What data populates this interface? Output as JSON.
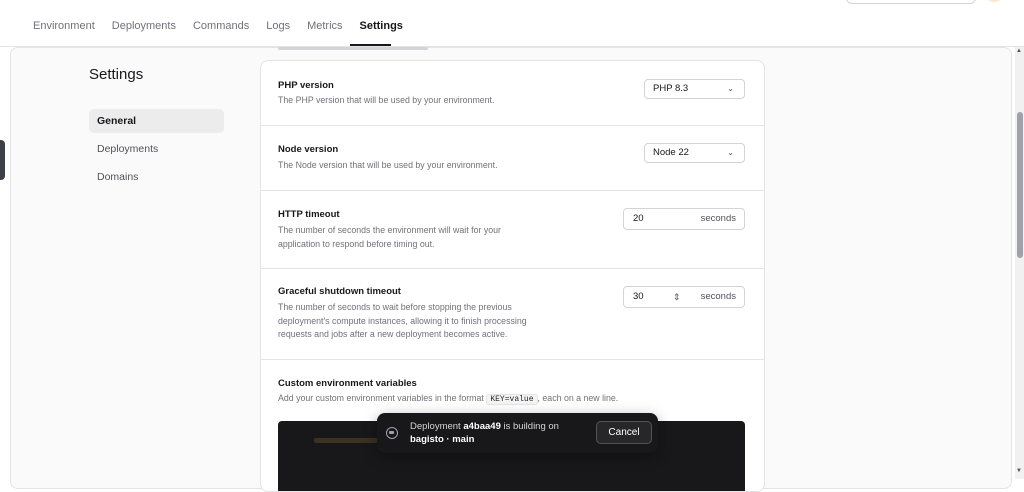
{
  "topnav": {
    "tabs": [
      {
        "label": "Environment"
      },
      {
        "label": "Deployments"
      },
      {
        "label": "Commands"
      },
      {
        "label": "Logs"
      },
      {
        "label": "Metrics"
      },
      {
        "label": "Settings"
      }
    ],
    "active_tab": "Settings"
  },
  "sidebar": {
    "title": "Settings",
    "items": [
      {
        "label": "General"
      },
      {
        "label": "Deployments"
      },
      {
        "label": "Domains"
      }
    ],
    "active_item": "General"
  },
  "settings": {
    "php": {
      "title": "PHP version",
      "description": "The PHP version that will be used by your environment.",
      "value": "PHP 8.3"
    },
    "node": {
      "title": "Node version",
      "description": "The Node version that will be used by your environment.",
      "value": "Node 22"
    },
    "http_timeout": {
      "title": "HTTP timeout",
      "description_line1": "The number of seconds the environment will wait for your",
      "description_line2": "application to respond before timing out.",
      "value": "20",
      "unit": "seconds"
    },
    "graceful_shutdown": {
      "title": "Graceful shutdown timeout",
      "description_line1": "The number of seconds to wait before stopping the previous",
      "description_line2": "deployment's compute instances, allowing it to finish processing",
      "description_line3": "requests and jobs after a new deployment becomes active.",
      "value": "30",
      "unit": "seconds"
    },
    "env_vars": {
      "title": "Custom environment variables",
      "description_before": "Add your custom environment variables in the format",
      "description_code": "KEY=value",
      "description_after": ", each on a new line."
    }
  },
  "toast": {
    "prefix": "Deployment",
    "commit": "a4baa49",
    "middle": "is building on",
    "target": "bagisto · main",
    "cancel_label": "Cancel"
  },
  "colors": {
    "accent": "#18181b",
    "toast_bg": "#18181b"
  }
}
